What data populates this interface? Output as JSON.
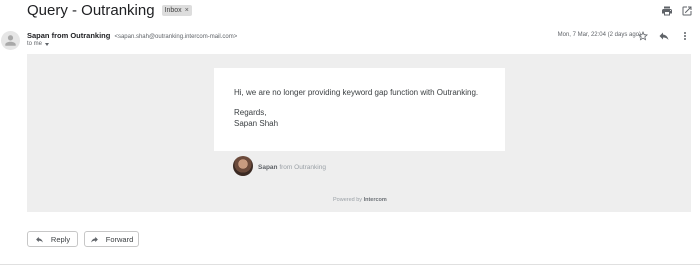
{
  "email": {
    "subject": "Query - Outranking",
    "label": "Inbox",
    "label_remove_glyph": "×",
    "sender_name": "Sapan from Outranking",
    "sender_email": "<sapan.shah@outranking.intercom-mail.com>",
    "recipient": "to me",
    "date": "Mon, 7 Mar, 22:04 (2 days ago)",
    "body_lines": [
      "Hi, we are no longer providing keyword gap function with Outranking.",
      "Regards,",
      "Sapan Shah"
    ],
    "signature_name": "Sapan",
    "signature_company": "from Outranking",
    "powered_by_prefix": "Powered by",
    "powered_by_brand": "Intercom"
  },
  "toolbar": {
    "icons": [
      "print-icon",
      "open-in-new-icon"
    ]
  },
  "message_actions": {
    "icons": [
      "star-icon",
      "reply-icon",
      "more-vert-icon"
    ]
  },
  "actions": {
    "reply_label": "Reply",
    "forward_label": "Forward"
  },
  "colors": {
    "panel_bg": "#eeeeee",
    "card_bg": "#ffffff",
    "text_primary": "#202124",
    "text_secondary": "#5f6368"
  }
}
